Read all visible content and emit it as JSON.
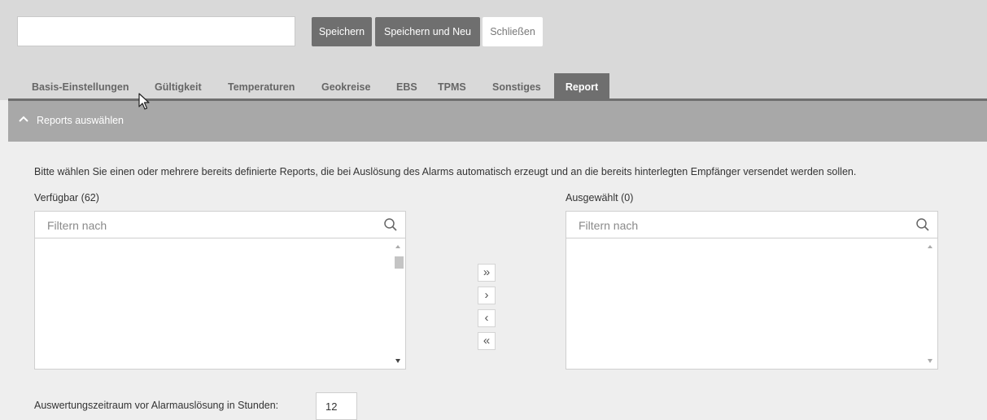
{
  "toolbar": {
    "name_value": "",
    "save_label": "Speichern",
    "save_new_label": "Speichern und Neu",
    "close_label": "Schließen"
  },
  "tabs": [
    {
      "label": "Basis-Einstellungen"
    },
    {
      "label": "Gültigkeit"
    },
    {
      "label": "Temperaturen"
    },
    {
      "label": "Geokreise"
    },
    {
      "label": "EBS"
    },
    {
      "label": "TPMS"
    },
    {
      "label": "Sonstiges"
    },
    {
      "label": "Report",
      "active": true
    }
  ],
  "section": {
    "title": "Reports auswählen",
    "expanded": true
  },
  "description": "Bitte wählen Sie einen oder mehrere bereits definierte Reports, die bei Auslösung des Alarms automatisch erzeugt und an die bereits hinterlegten Empfänger versendet werden sollen.",
  "available": {
    "label": "Verfügbar (62)",
    "filter_placeholder": "Filtern nach",
    "filter_value": ""
  },
  "selected": {
    "label": "Ausgewählt (0)",
    "filter_placeholder": "Filtern nach",
    "filter_value": ""
  },
  "transfer_buttons": {
    "move_all_right": "»",
    "move_right": "›",
    "move_left": "‹",
    "move_all_left": "«"
  },
  "evaluation": {
    "label": "Auswertungszeitraum vor Alarmauslösung in Stunden:",
    "value": "12"
  },
  "colors": {
    "accent_dark": "#6f6f6f",
    "section_header": "#a8a8a8",
    "background": "#eeeeee",
    "toolbar_background": "#d9d9d9"
  }
}
